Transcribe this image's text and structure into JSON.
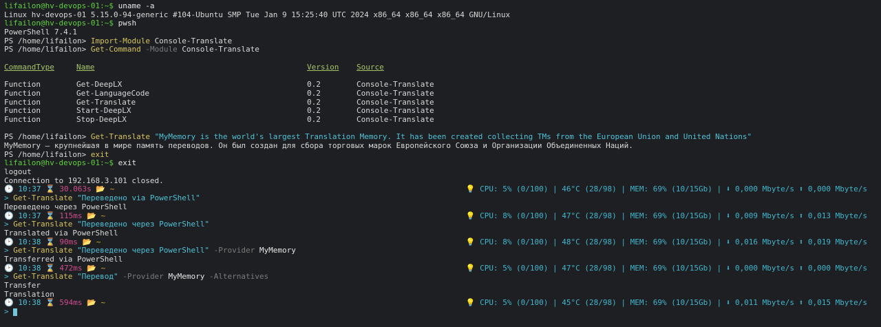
{
  "colors": {
    "background": "#1e1f22",
    "prompt": "#5fcf3f",
    "cmdlet": "#d7c35f",
    "header": "#a6c567",
    "cyan": "#4ec2d8",
    "pink": "#d04c8f"
  },
  "session": {
    "line1_prompt": "lifailon@hv-devops-01:~$",
    "line1_cmd": " uname -a",
    "line2": "Linux hv-devops-01 5.15.0-94-generic #104-Ubuntu SMP Tue Jan 9 15:25:40 UTC 2024 x86_64 x86_64 x86_64 GNU/Linux",
    "line3_prompt": "lifailon@hv-devops-01:~$",
    "line3_cmd": " pwsh",
    "line4": "PowerShell 7.4.1",
    "ps_prompt": "PS /home/lifailon>",
    "import_cmd": "Import-Module",
    "import_arg": "Console-Translate",
    "getcmd_cmd": "Get-Command",
    "getcmd_param": "-Module",
    "getcmd_arg": "Console-Translate"
  },
  "table": {
    "headers": [
      "CommandType",
      "Name",
      "Version",
      "Source"
    ],
    "rows": [
      [
        "Function",
        "Get-DeepLX",
        "0.2",
        "Console-Translate"
      ],
      [
        "Function",
        "Get-LanguageCode",
        "0.2",
        "Console-Translate"
      ],
      [
        "Function",
        "Get-Translate",
        "0.2",
        "Console-Translate"
      ],
      [
        "Function",
        "Start-DeepLX",
        "0.2",
        "Console-Translate"
      ],
      [
        "Function",
        "Stop-DeepLX",
        "0.2",
        "Console-Translate"
      ]
    ]
  },
  "translate1": {
    "cmd": "Get-Translate",
    "arg": "\"MyMemory is the world's largest Translation Memory. It has been created collecting TMs from the European Union and United Nations\"",
    "output": "MyMemory – крупнейшая в мире память переводов. Он был создан для сбора торговых марок Европейского Союза и Организации Объединенных Наций.",
    "exit_cmd": "exit",
    "exit2_prompt": "lifailon@hv-devops-01:~$",
    "exit2_cmd": " exit",
    "logout": "logout",
    "closed": "Connection to 192.168.3.101 closed."
  },
  "prompts": [
    {
      "time": "10:37",
      "dur": "30.063s",
      "cpu": "CPU: 5% (0/100) | 46°C (28/98) | MEM: 69% (10/15Gb) | ⬇ 0,000 Mbyte/s ⬆ 0,000 Mbyte/s"
    },
    {
      "time": "10:37",
      "dur": "115ms",
      "cpu": "CPU: 8% (0/100) | 47°C (28/98) | MEM: 69% (10/15Gb) | ⬇ 0,009 Mbyte/s ⬆ 0,013 Mbyte/s"
    },
    {
      "time": "10:38",
      "dur": "90ms",
      "cpu": "CPU: 8% (0/100) | 48°C (28/98) | MEM: 69% (10/15Gb) | ⬇ 0,016 Mbyte/s ⬆ 0,019 Mbyte/s"
    },
    {
      "time": "10:38",
      "dur": "472ms",
      "cpu": "CPU: 5% (0/100) | 47°C (28/98) | MEM: 69% (10/15Gb) | ⬇ 0,000 Mbyte/s ⬆ 0,000 Mbyte/s"
    },
    {
      "time": "10:38",
      "dur": "594ms",
      "cpu": "CPU: 5% (0/100) | 45°C (28/98) | MEM: 69% (10/15Gb) | ⬇ 0,011 Mbyte/s ⬆ 0,015 Mbyte/s"
    }
  ],
  "commands": [
    {
      "cmd": "Get-Translate",
      "arg": "\"Переведено via PowerShell\"",
      "output": "Переведено через PowerShell"
    },
    {
      "cmd": "Get-Translate",
      "arg": "\"Переведено через PowerShell\"",
      "output": "Translated via PowerShell"
    },
    {
      "cmd": "Get-Translate",
      "arg": "\"Переведено через PowerShell\"",
      "param": "-Provider",
      "value": "MyMemory",
      "output": "Transferred via PowerShell"
    },
    {
      "cmd": "Get-Translate",
      "arg": "\"Перевод\"",
      "param": "-Provider",
      "value": "MyMemory",
      "param2": "-Alternatives",
      "output": "Transfer",
      "output2": "Translation"
    }
  ],
  "glyphs": {
    "arrow": ">",
    "tilde": "~",
    "clock": "🕑",
    "hourglass": "⌛",
    "folder": "📂",
    "bulb": "💡"
  }
}
